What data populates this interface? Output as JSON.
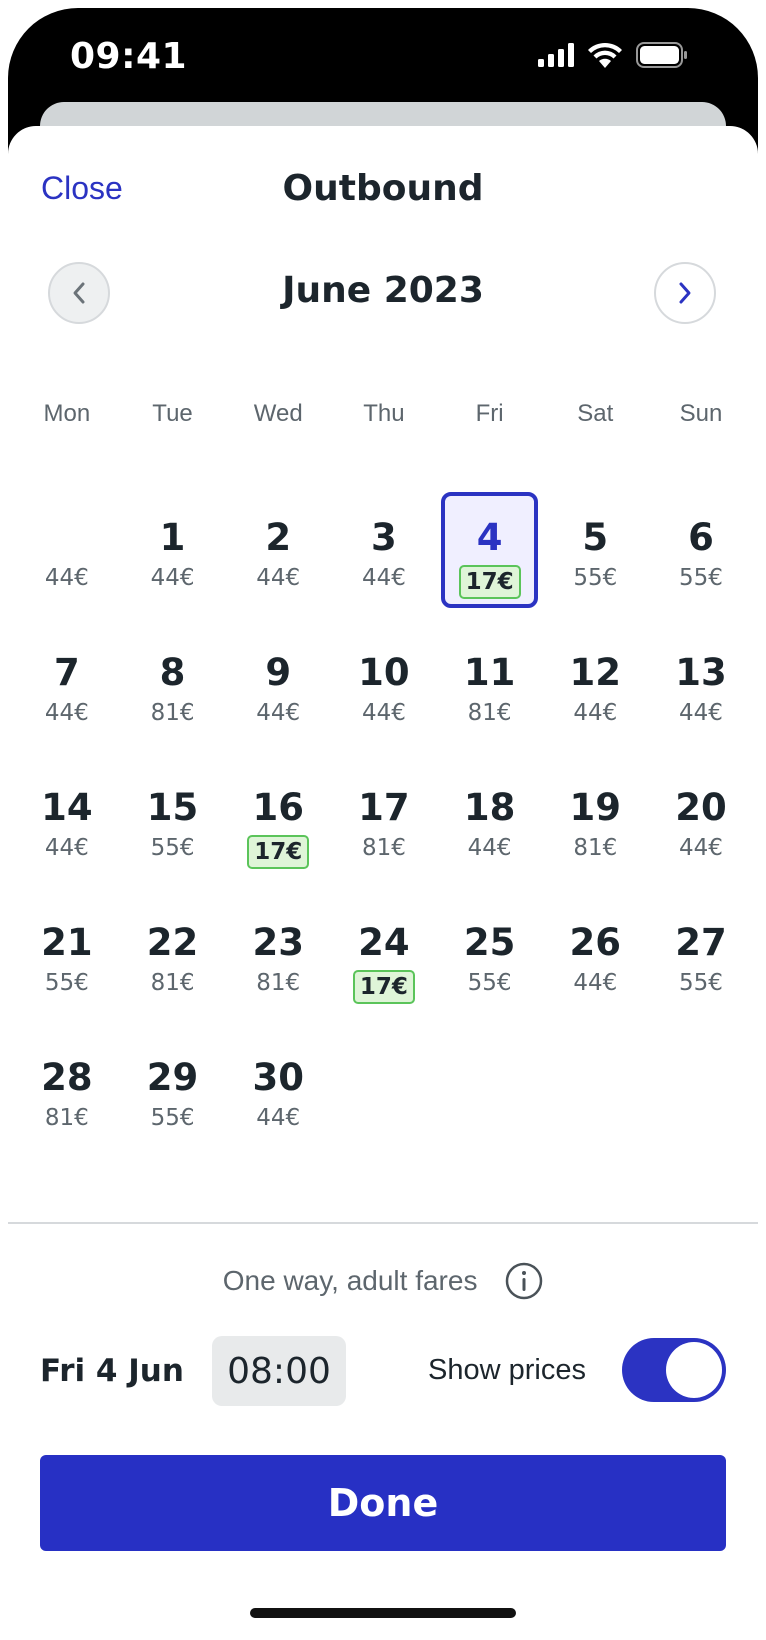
{
  "status_bar": {
    "time": "09:41"
  },
  "header": {
    "close_label": "Close",
    "title": "Outbound"
  },
  "calendar": {
    "month_label": "June 2023",
    "weekdays": [
      "Mon",
      "Tue",
      "Wed",
      "Thu",
      "Fri",
      "Sat",
      "Sun"
    ],
    "weeks": [
      [
        {
          "day": "",
          "price": "44€"
        },
        {
          "day": "1",
          "price": "44€"
        },
        {
          "day": "2",
          "price": "44€"
        },
        {
          "day": "3",
          "price": "44€"
        },
        {
          "day": "4",
          "price": "17€",
          "cheap": true,
          "selected": true
        },
        {
          "day": "5",
          "price": "55€"
        },
        {
          "day": "6",
          "price": "55€"
        }
      ],
      [
        {
          "day": "7",
          "price": "44€"
        },
        {
          "day": "8",
          "price": "81€"
        },
        {
          "day": "9",
          "price": "44€"
        },
        {
          "day": "10",
          "price": "44€"
        },
        {
          "day": "11",
          "price": "81€"
        },
        {
          "day": "12",
          "price": "44€"
        },
        {
          "day": "13",
          "price": "44€"
        }
      ],
      [
        {
          "day": "14",
          "price": "44€"
        },
        {
          "day": "15",
          "price": "55€"
        },
        {
          "day": "16",
          "price": "17€",
          "cheap": true
        },
        {
          "day": "17",
          "price": "81€"
        },
        {
          "day": "18",
          "price": "44€"
        },
        {
          "day": "19",
          "price": "81€"
        },
        {
          "day": "20",
          "price": "44€"
        }
      ],
      [
        {
          "day": "21",
          "price": "55€"
        },
        {
          "day": "22",
          "price": "81€"
        },
        {
          "day": "23",
          "price": "81€"
        },
        {
          "day": "24",
          "price": "17€",
          "cheap": true
        },
        {
          "day": "25",
          "price": "55€"
        },
        {
          "day": "26",
          "price": "44€"
        },
        {
          "day": "27",
          "price": "55€"
        }
      ],
      [
        {
          "day": "28",
          "price": "81€"
        },
        {
          "day": "29",
          "price": "55€"
        },
        {
          "day": "30",
          "price": "44€"
        }
      ]
    ]
  },
  "footer": {
    "fares_text": "One way, adult fares",
    "selected_date": "Fri 4 Jun",
    "time_value": "08:00",
    "show_prices_label": "Show prices",
    "show_prices_on": true,
    "done_label": "Done"
  },
  "colors": {
    "accent": "#2b33c2",
    "cheap_bg": "#dff5d8",
    "cheap_border": "#5bc45a"
  }
}
